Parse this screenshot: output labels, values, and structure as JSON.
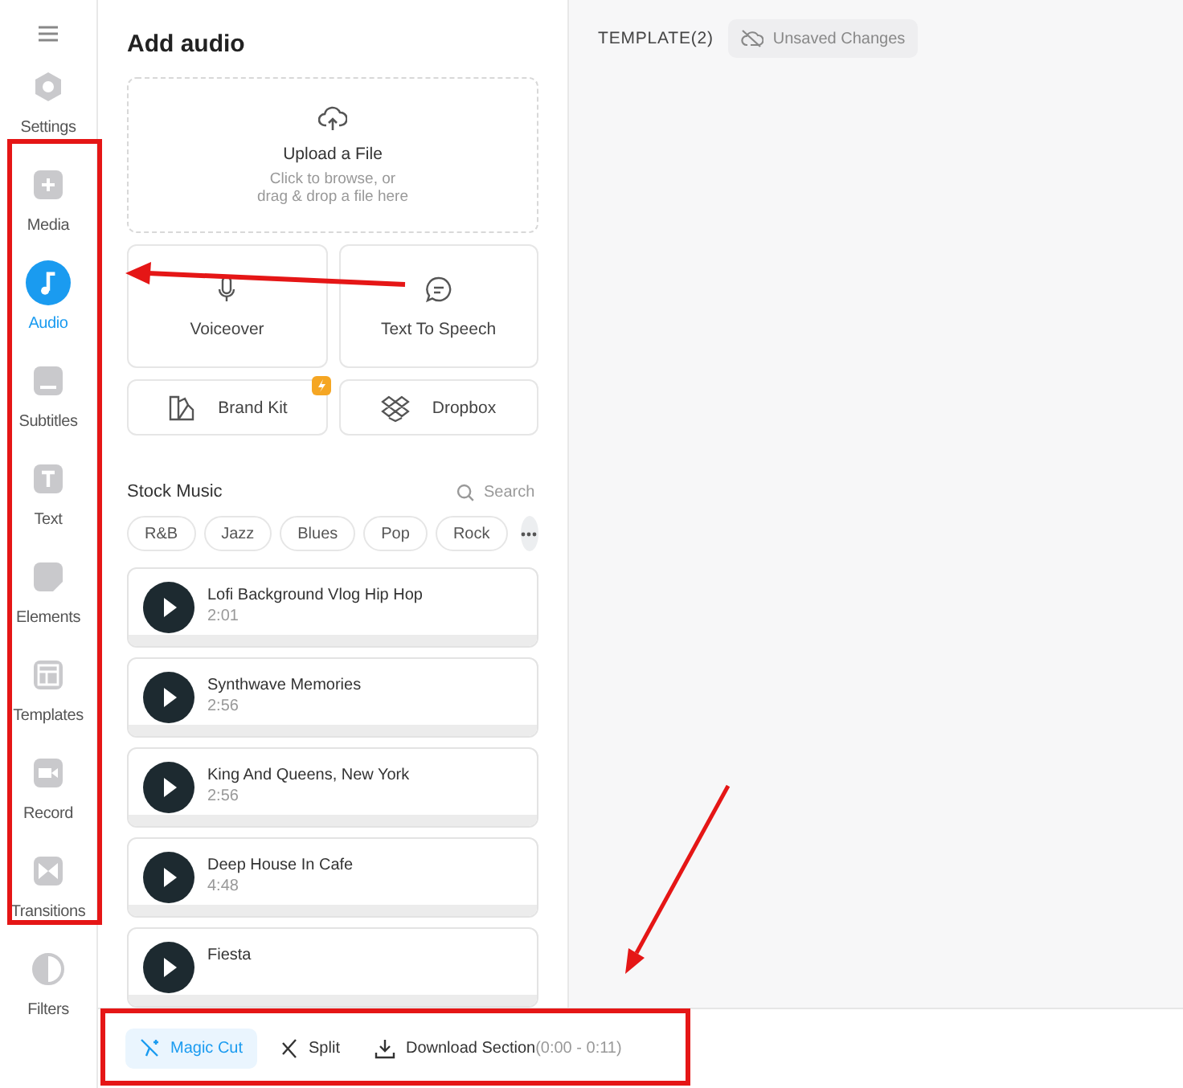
{
  "sidebar": {
    "settings": {
      "label": "Settings"
    },
    "items": [
      {
        "label": "Media",
        "selected": false
      },
      {
        "label": "Audio",
        "selected": true
      },
      {
        "label": "Subtitles",
        "selected": false
      },
      {
        "label": "Text",
        "selected": false
      },
      {
        "label": "Elements",
        "selected": false
      },
      {
        "label": "Templates",
        "selected": false
      },
      {
        "label": "Record",
        "selected": false
      },
      {
        "label": "Transitions",
        "selected": false
      },
      {
        "label": "Filters",
        "selected": false
      }
    ]
  },
  "panel": {
    "title": "Add audio",
    "upload": {
      "title": "Upload a File",
      "hint_lines": [
        "Click to browse, or",
        "drag & drop a file here"
      ]
    },
    "sources": [
      {
        "label": "Voiceover",
        "kind": "tall",
        "premium": false
      },
      {
        "label": "Text To Speech",
        "kind": "tall",
        "premium": false
      },
      {
        "label": "Brand Kit",
        "kind": "wide",
        "premium": true
      },
      {
        "label": "Dropbox",
        "kind": "wide",
        "premium": false
      }
    ],
    "stock_music": {
      "title": "Stock Music",
      "search": {
        "placeholder": "Search"
      },
      "genres": [
        "R&B",
        "Jazz",
        "Blues",
        "Pop",
        "Rock"
      ],
      "tracks": [
        {
          "title": "Lofi Background Vlog Hip Hop",
          "duration": "2:01"
        },
        {
          "title": "Synthwave Memories",
          "duration": "2:56"
        },
        {
          "title": "King And Queens, New York",
          "duration": "2:56"
        },
        {
          "title": "Deep House In Cafe",
          "duration": "4:48"
        },
        {
          "title": "Fiesta"
        }
      ]
    }
  },
  "header": {
    "title": "TEMPLATE(2)",
    "status": "Unsaved Changes"
  },
  "toolbar": [
    {
      "label": "Magic Cut",
      "selected": true
    },
    {
      "label": "Split",
      "selected": false
    },
    {
      "label": "Download Section",
      "suffix": "(0:00 - 0:11)",
      "selected": false
    }
  ]
}
